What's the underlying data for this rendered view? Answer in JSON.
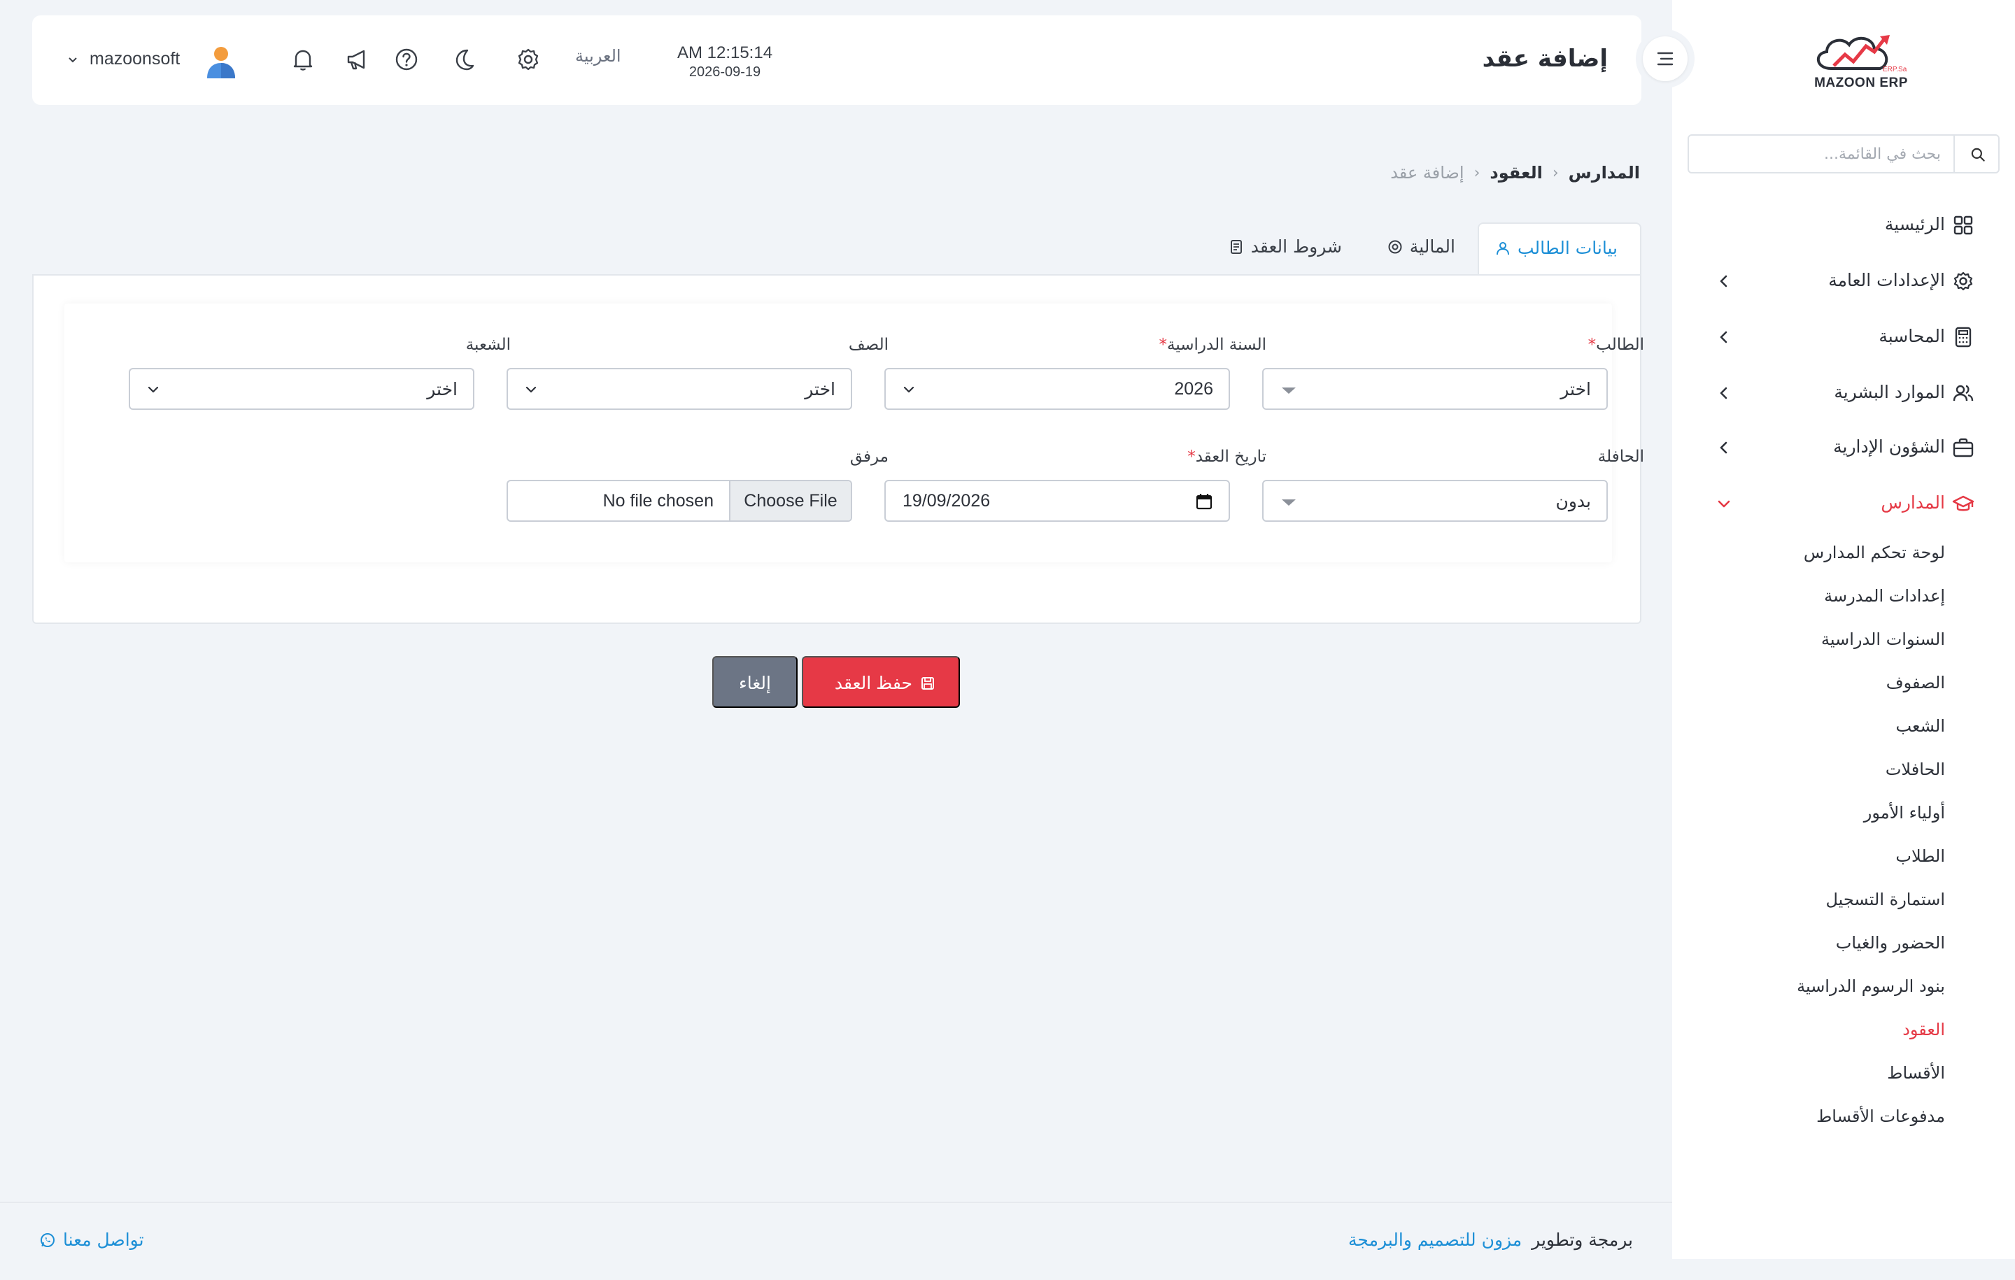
{
  "brand": {
    "logo_text": "MAZOON ERP",
    "logo_small": "ERP.Sa"
  },
  "sidebar": {
    "search_placeholder": "بحث في القائمة...",
    "items": [
      {
        "label": "الرئيسية",
        "icon": "grid-icon"
      },
      {
        "label": "الإعدادات العامة",
        "icon": "gear-icon"
      },
      {
        "label": "المحاسبة",
        "icon": "calculator-icon"
      },
      {
        "label": "الموارد البشرية",
        "icon": "users-icon"
      },
      {
        "label": "الشؤون الإدارية",
        "icon": "briefcase-icon"
      },
      {
        "label": "المدارس",
        "icon": "graduation-cap-icon"
      }
    ],
    "sub_items": [
      "لوحة تحكم المدارس",
      "إعدادات المدرسة",
      "السنوات الدراسية",
      "الصفوف",
      "الشعب",
      "الحافلات",
      "أولياء الأمور",
      "الطلاب",
      "استمارة التسجيل",
      "الحضور والغياب",
      "بنود الرسوم الدراسية",
      "العقود",
      "الأقساط",
      "مدفوعات الأقساط"
    ],
    "active_sub": "العقود"
  },
  "header": {
    "title": "إضافة عقد",
    "time": "AM 12:15:14",
    "date": "2026-09-19",
    "language": "العربية",
    "username": "mazoonsoft"
  },
  "breadcrumb": {
    "root": "المدارس",
    "parent": "العقود",
    "current": "إضافة عقد"
  },
  "tabs": [
    {
      "label": "بيانات الطالب",
      "icon": "user-icon",
      "active": true
    },
    {
      "label": "المالية",
      "icon": "coin-icon",
      "active": false
    },
    {
      "label": "شروط العقد",
      "icon": "document-icon",
      "active": false
    }
  ],
  "form": {
    "student": {
      "label": "الطالب",
      "required": true,
      "value": "اختر"
    },
    "academic_year": {
      "label": "السنة الدراسية",
      "required": true,
      "value": "2026"
    },
    "grade": {
      "label": "الصف",
      "required": false,
      "value": "اختر"
    },
    "section": {
      "label": "الشعبة",
      "required": false,
      "value": "اختر"
    },
    "bus": {
      "label": "الحافلة",
      "required": false,
      "value": "بدون"
    },
    "contract_date": {
      "label": "تاريخ العقد",
      "required": true,
      "value": "19/09/2026"
    },
    "attachment": {
      "label": "مرفق",
      "button": "Choose File",
      "status": "No file chosen"
    }
  },
  "actions": {
    "save": "حفظ العقد",
    "cancel": "إلغاء"
  },
  "footer": {
    "credit_prefix": "برمجة وتطوير",
    "credit_link": "مزون للتصميم والبرمجة",
    "contact": "تواصل معنا"
  },
  "colors": {
    "accent": "#e63946",
    "link": "#1d8fd6",
    "cancel": "#6c7585",
    "background": "#f1f4f8"
  }
}
